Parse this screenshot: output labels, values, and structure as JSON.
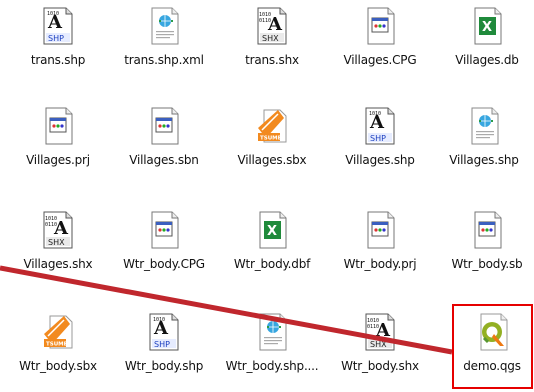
{
  "files": [
    {
      "name": "trans.shp",
      "icon": "shp-file-icon"
    },
    {
      "name": "trans.shp.xml",
      "icon": "xml-file-icon"
    },
    {
      "name": "trans.shx",
      "icon": "shx-file-icon"
    },
    {
      "name": "Villages.CPG",
      "icon": "generic-file-icon"
    },
    {
      "name": "Villages.db",
      "icon": "excel-file-icon"
    },
    {
      "name": "Villages.prj",
      "icon": "generic-file-icon"
    },
    {
      "name": "Villages.sbn",
      "icon": "generic-file-icon"
    },
    {
      "name": "Villages.sbx",
      "icon": "tsume-file-icon"
    },
    {
      "name": "Villages.shp",
      "icon": "shp-file-icon"
    },
    {
      "name": "Villages.shp",
      "icon": "xml-file-icon"
    },
    {
      "name": "Villages.shx",
      "icon": "shx-file-icon"
    },
    {
      "name": "Wtr_body.CPG",
      "icon": "generic-file-icon"
    },
    {
      "name": "Wtr_body.dbf",
      "icon": "excel-file-icon"
    },
    {
      "name": "Wtr_body.prj",
      "icon": "generic-file-icon"
    },
    {
      "name": "Wtr_body.sb",
      "icon": "generic-file-icon"
    },
    {
      "name": "Wtr_body.sbx",
      "icon": "tsume-file-icon"
    },
    {
      "name": "Wtr_body.shp",
      "icon": "shp-file-icon"
    },
    {
      "name": "Wtr_body.shp....",
      "icon": "xml-file-icon"
    },
    {
      "name": "Wtr_body.shx",
      "icon": "shx-file-icon"
    },
    {
      "name": "demo.qgs",
      "icon": "qgis-project-icon"
    }
  ],
  "highlight": {
    "color": "#e60000",
    "target": "demo.qgs"
  },
  "annotation_line": {
    "color": "#c0272d"
  }
}
